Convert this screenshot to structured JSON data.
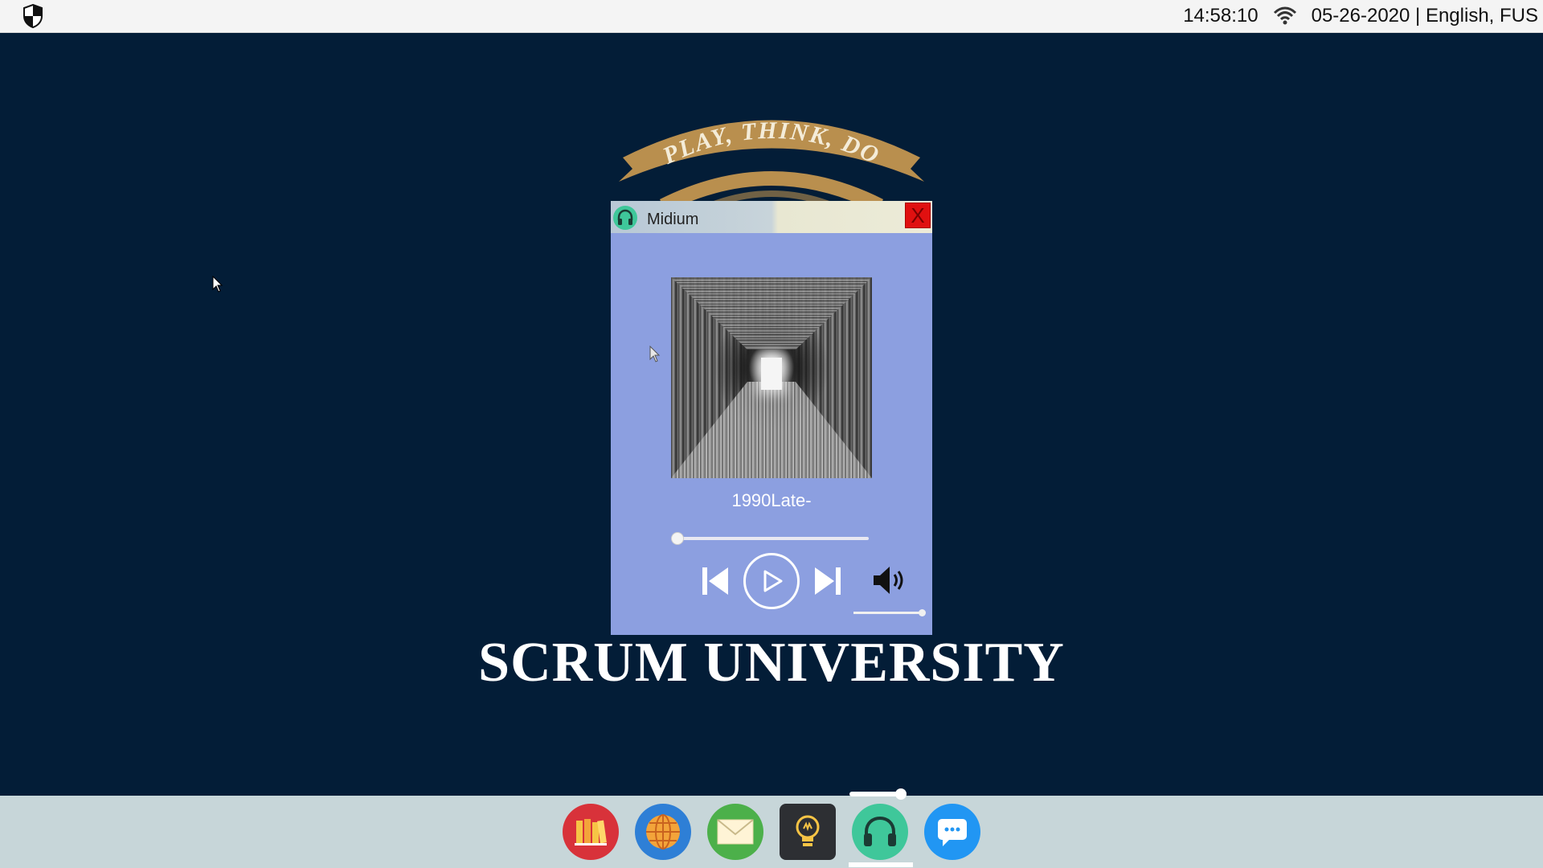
{
  "topbar": {
    "time": "14:58:10",
    "date_lang": "05-26-2020 | English, FUS",
    "logo_icon": "shield-logo-icon",
    "wifi_icon": "wifi-icon"
  },
  "desktop": {
    "banner_text": "PLAY, THINK, DO",
    "university_title": "SCRUM UNIVERSITY"
  },
  "player": {
    "window_title": "Midium",
    "close_label": "X",
    "track_title": "1990Late-",
    "progress": 0,
    "volume": 1,
    "app_icon": "headphones-icon",
    "controls": [
      "previous-icon",
      "play-icon",
      "next-icon",
      "volume-icon"
    ]
  },
  "dock": {
    "items": [
      {
        "name": "library",
        "icon": "books-icon",
        "color": "#d8323a"
      },
      {
        "name": "browser",
        "icon": "globe-icon",
        "color": "#2e7fd6"
      },
      {
        "name": "mail",
        "icon": "mail-icon",
        "color": "#4cb04a"
      },
      {
        "name": "ideas",
        "icon": "lightbulb-icon",
        "color": "#2d2f33"
      },
      {
        "name": "music",
        "icon": "headphones-icon",
        "color": "#3fc79a"
      },
      {
        "name": "chat",
        "icon": "chat-icon",
        "color": "#2196f3"
      }
    ],
    "active": "music"
  }
}
